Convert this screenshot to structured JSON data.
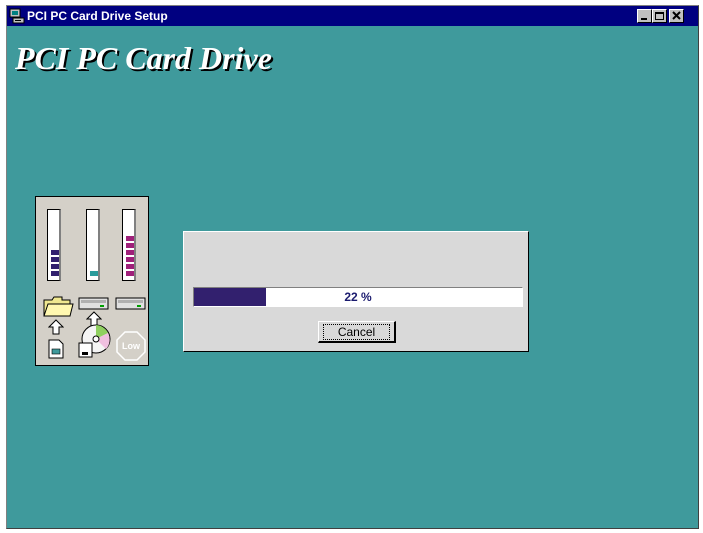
{
  "window": {
    "title": "PCI PC Card Drive Setup",
    "controls": [
      "minimize",
      "maximize",
      "close"
    ]
  },
  "heading": "PCI PC Card Drive",
  "meters": [
    {
      "name": "folder-meter",
      "color": "#32206e",
      "filled_segments": 4
    },
    {
      "name": "drive-meter",
      "color": "#2a9c9c",
      "filled_segments": 1
    },
    {
      "name": "space-meter",
      "color": "#a0207a",
      "filled_segments": 6
    }
  ],
  "icons": [
    "folder-icon",
    "drive-icon",
    "drive-icon",
    "up-arrow-icon",
    "up-arrow-icon",
    "file-icon",
    "cd-disk-icon",
    "low-stop-icon"
  ],
  "low_label": "Low",
  "progress": {
    "percent": 22,
    "text": "22 %"
  },
  "buttons": {
    "cancel": "Cancel"
  }
}
